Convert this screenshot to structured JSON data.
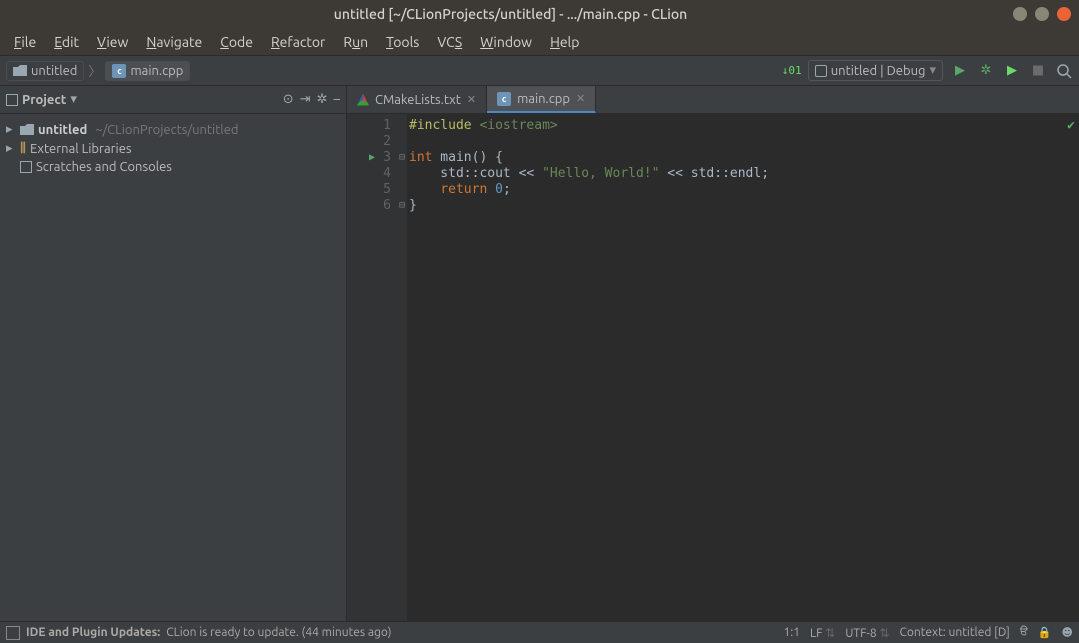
{
  "window": {
    "title": "untitled [~/CLionProjects/untitled] - .../main.cpp - CLion"
  },
  "menu": {
    "file": "File",
    "edit": "Edit",
    "view": "View",
    "navigate": "Navigate",
    "code": "Code",
    "refactor": "Refactor",
    "run": "Run",
    "tools": "Tools",
    "vcs": "VCS",
    "window": "Window",
    "help": "Help"
  },
  "breadcrumbs": {
    "root": "untitled",
    "file": "main.cpp"
  },
  "run_config": {
    "label": "untitled | Debug"
  },
  "project_panel": {
    "title": "Project",
    "tree": {
      "root_name": "untitled",
      "root_path": "~/CLionProjects/untitled",
      "external_libs": "External Libraries",
      "scratches": "Scratches and Consoles"
    }
  },
  "tabs": {
    "cmake": "CMakeLists.txt",
    "main": "main.cpp"
  },
  "code": {
    "l1a": "#include",
    "l1b": " <iostream>",
    "l2": "",
    "l3a": "int",
    "l3b": " main() {",
    "l4a": "    std::cout << ",
    "l4b": "\"Hello, World!\"",
    "l4c": " << std::endl;",
    "l5a": "    ",
    "l5b": "return",
    "l5c": " ",
    "l5d": "0",
    "l5e": ";",
    "l6": "}"
  },
  "gutter": {
    "l1": "1",
    "l2": "2",
    "l3": "3",
    "l4": "4",
    "l5": "5",
    "l6": "6"
  },
  "status": {
    "msg_title": "IDE and Plugin Updates:",
    "msg_body": "CLion is ready to update. (44 minutes ago)",
    "pos": "1:1",
    "line_sep": "LF",
    "encoding": "UTF-8",
    "context": "Context: untitled [D]"
  }
}
